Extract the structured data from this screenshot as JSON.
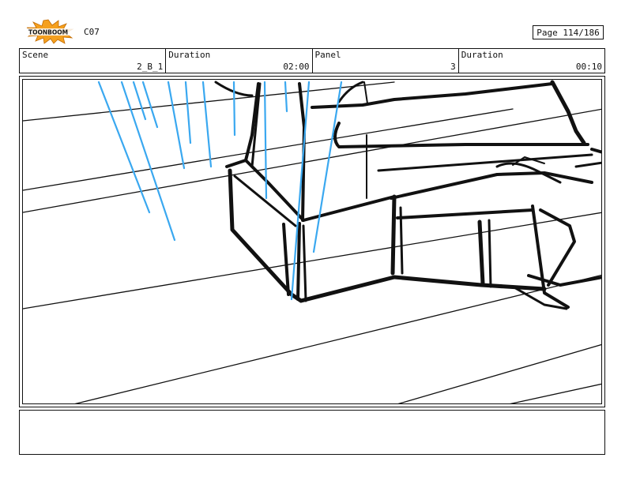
{
  "header": {
    "logo_text": "TOONBOOM",
    "sequence": "C07",
    "page": "Page 114/186"
  },
  "info": {
    "scene_label": "Scene",
    "scene_value": "2_B_1",
    "duration_label": "Duration",
    "duration_value": "02:00",
    "panel_label": "Panel",
    "panel_value": "3",
    "panel_duration_label": "Duration",
    "panel_duration_value": "00:10"
  },
  "notes": {
    "text": ""
  },
  "colors": {
    "sketch_ink": "#111111",
    "light_rays": "#3aa8f0",
    "logo_burst": "#f5a01e"
  },
  "icons": [
    "toonboom-logo"
  ]
}
